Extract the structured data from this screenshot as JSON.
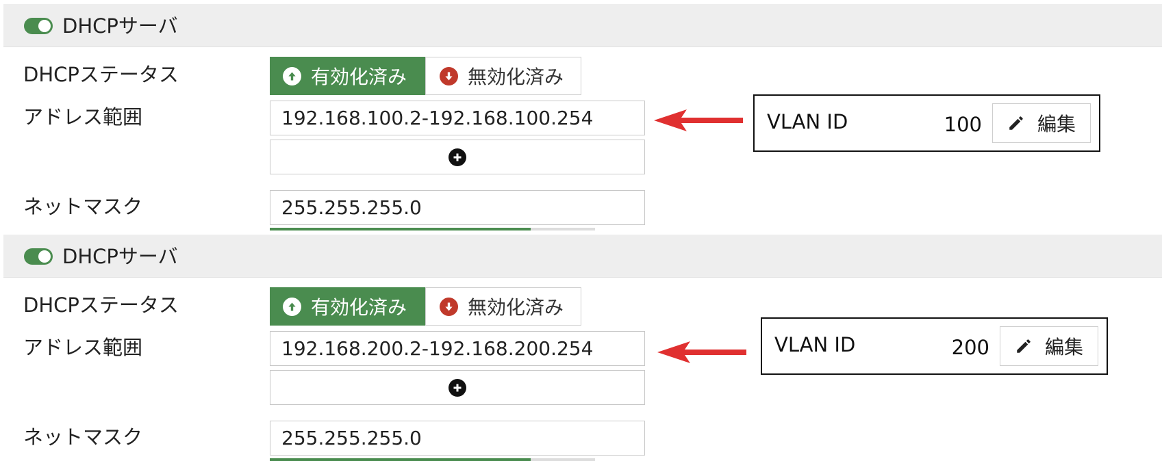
{
  "colors": {
    "accent": "#4a8c4f",
    "danger": "#c0392b",
    "annotation_arrow": "#e03030",
    "header_bg": "#eeeeee"
  },
  "panels": [
    {
      "header": {
        "toggle_on": true,
        "title": "DHCPサーバ"
      },
      "labels": {
        "status": "DHCPステータス",
        "range": "アドレス範囲",
        "netmask": "ネットマスク"
      },
      "status": {
        "enabled": "有効化済み",
        "disabled": "無効化済み",
        "selected": "enabled"
      },
      "address_range": "192.168.100.2-192.168.100.254",
      "netmask": "255.255.255.0",
      "annotation": {
        "label": "VLAN ID",
        "value": "100",
        "edit_label": "編集"
      },
      "icons": {
        "up": "arrow-circle-up-icon",
        "down": "arrow-circle-down-icon",
        "add": "plus-circle-icon",
        "edit": "pencil-icon"
      }
    },
    {
      "header": {
        "toggle_on": true,
        "title": "DHCPサーバ"
      },
      "labels": {
        "status": "DHCPステータス",
        "range": "アドレス範囲",
        "netmask": "ネットマスク"
      },
      "status": {
        "enabled": "有効化済み",
        "disabled": "無効化済み",
        "selected": "enabled"
      },
      "address_range": "192.168.200.2-192.168.200.254",
      "netmask": "255.255.255.0",
      "annotation": {
        "label": "VLAN ID",
        "value": "200",
        "edit_label": "編集"
      },
      "icons": {
        "up": "arrow-circle-up-icon",
        "down": "arrow-circle-down-icon",
        "add": "plus-circle-icon",
        "edit": "pencil-icon"
      }
    }
  ]
}
